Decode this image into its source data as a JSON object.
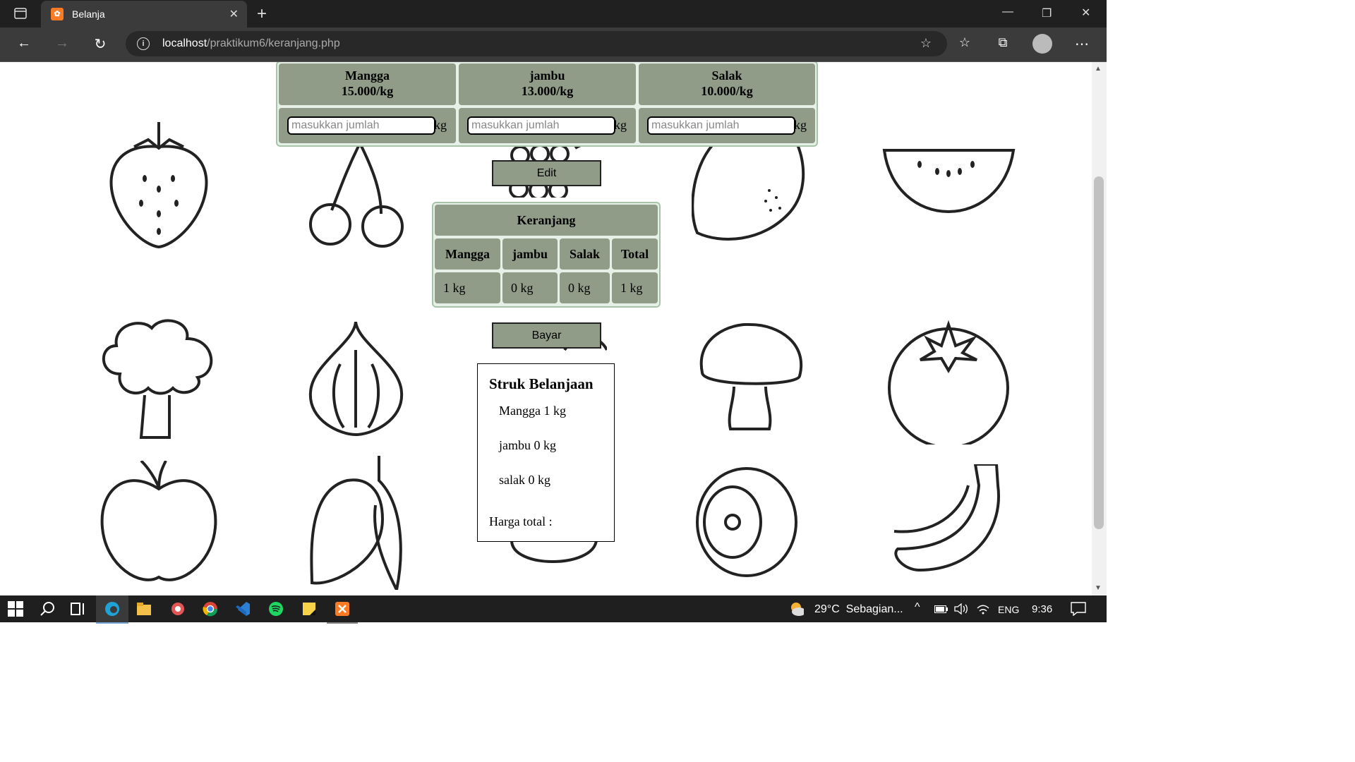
{
  "browser": {
    "tab_title": "Belanja",
    "url_host": "localhost",
    "url_path": "/praktikum6/keranjang.php"
  },
  "products": [
    {
      "name": "Mangga",
      "price": "15.000/kg",
      "placeholder": "masukkan jumlah",
      "unit": "kg"
    },
    {
      "name": "jambu",
      "price": "13.000/kg",
      "placeholder": "masukkan jumlah",
      "unit": "kg"
    },
    {
      "name": "Salak",
      "price": "10.000/kg",
      "placeholder": "masukkan jumlah",
      "unit": "kg"
    }
  ],
  "edit_button": "Edit",
  "cart": {
    "title": "Keranjang",
    "headers": [
      "Mangga",
      "jambu",
      "Salak",
      "Total"
    ],
    "values": [
      "1 kg",
      "0 kg",
      "0 kg",
      "1 kg"
    ]
  },
  "pay_button": "Bayar",
  "receipt": {
    "title": "Struk Belanjaan",
    "items": [
      "Mangga 1 kg",
      "jambu 0 kg",
      "salak 0 kg"
    ],
    "total_label": "Harga total :"
  },
  "taskbar": {
    "weather": "29°C  Sebagian...",
    "language": "ENG",
    "time": "9:36"
  },
  "colors": {
    "cell_bg": "#909b88",
    "table_bg": "#e7f0e7",
    "chrome_dark": "#202020"
  }
}
